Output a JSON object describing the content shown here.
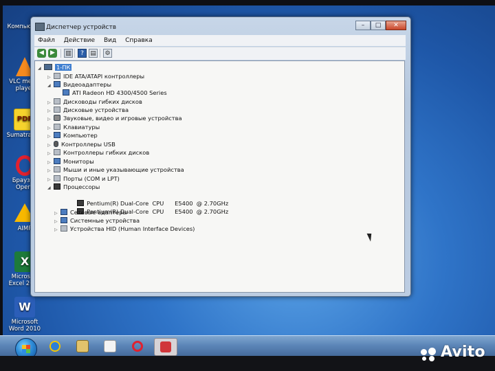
{
  "desktop": {
    "icons": [
      {
        "label": "Компьютер"
      },
      {
        "label": "VLC media player"
      },
      {
        "label": "SumatraPDF"
      },
      {
        "label": "Браузер Opera"
      },
      {
        "label": "AIMP"
      },
      {
        "label": "Microsoft Excel 2010"
      },
      {
        "label": "Microsoft Word 2010"
      }
    ]
  },
  "window": {
    "title": "Диспетчер устройств",
    "controls": {
      "minimize": "–",
      "maximize": "□",
      "close": "✕"
    },
    "menu": [
      "Файл",
      "Действие",
      "Вид",
      "Справка"
    ],
    "toolbar": {
      "back": "◀",
      "forward": "▶",
      "up": "▥",
      "help": "?",
      "properties": "▤",
      "scan": "⚙"
    },
    "tree": {
      "root": "1-ПК",
      "categories": [
        {
          "label": "IDE ATA/ATAPI контроллеры",
          "expanded": false
        },
        {
          "label": "Видеоадаптеры",
          "expanded": true,
          "children": [
            "ATI Radeon HD 4300/4500 Series"
          ]
        },
        {
          "label": "Дисководы гибких дисков",
          "expanded": false
        },
        {
          "label": "Дисковые устройства",
          "expanded": false
        },
        {
          "label": "Звуковые, видео и игровые устройства",
          "expanded": false
        },
        {
          "label": "Клавиатуры",
          "expanded": false
        },
        {
          "label": "Компьютер",
          "expanded": false
        },
        {
          "label": "Контроллеры USB",
          "expanded": false
        },
        {
          "label": "Контроллеры гибких дисков",
          "expanded": false
        },
        {
          "label": "Мониторы",
          "expanded": false
        },
        {
          "label": "Мыши и иные указывающие устройства",
          "expanded": false
        },
        {
          "label": "Порты (COM и LPT)",
          "expanded": false
        },
        {
          "label": "Процессоры",
          "expanded": true,
          "children": [
            "Pentium(R) Dual-Core  CPU      E5400  @ 2.70GHz",
            "Pentium(R) Dual-Core  CPU      E5400  @ 2.70GHz"
          ]
        },
        {
          "label": "Сетевые адаптеры",
          "expanded": false
        },
        {
          "label": "Системные устройства",
          "expanded": false
        },
        {
          "label": "Устройства HID (Human Interface Devices)",
          "expanded": false
        }
      ]
    }
  },
  "taskbar": {
    "items": [
      "start",
      "internet-explorer",
      "windows-explorer",
      "media-player",
      "opera",
      "device-manager"
    ]
  },
  "watermark": {
    "text": "Avito"
  },
  "colors": {
    "selection": "#3f7fd0",
    "desktop": "#2f74c8",
    "close_button": "#c9462a"
  }
}
